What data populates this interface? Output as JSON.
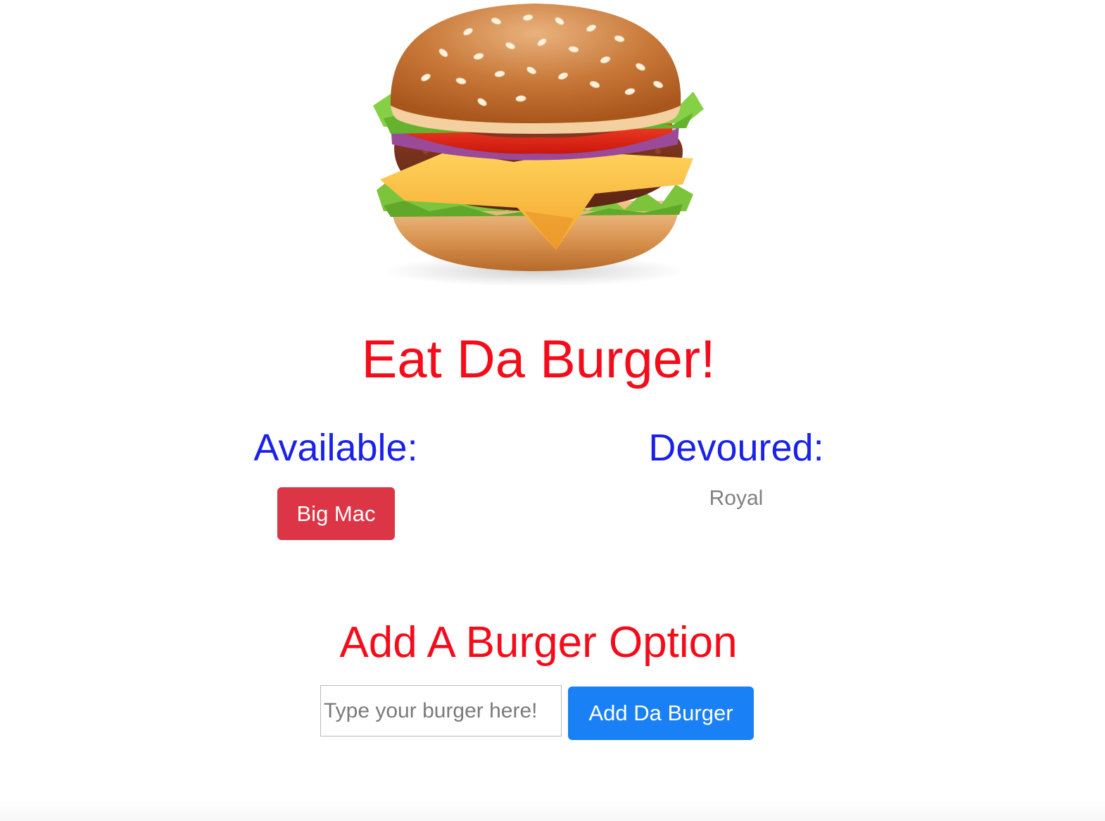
{
  "header": {
    "title": "Eat Da Burger!",
    "image_icon": "burger-image"
  },
  "available": {
    "heading": "Available:",
    "items": [
      "Big Mac"
    ]
  },
  "devoured": {
    "heading": "Devoured:",
    "items": [
      "Royal"
    ]
  },
  "add_form": {
    "heading": "Add A Burger Option",
    "input_placeholder": "Type your burger here!",
    "input_value": "",
    "submit_label": "Add Da Burger"
  },
  "colors": {
    "title_red": "#f40c1b",
    "heading_blue": "#1a22e8",
    "danger_button": "#dc3545",
    "primary_button": "#1a80f5",
    "devoured_text": "#808080"
  }
}
